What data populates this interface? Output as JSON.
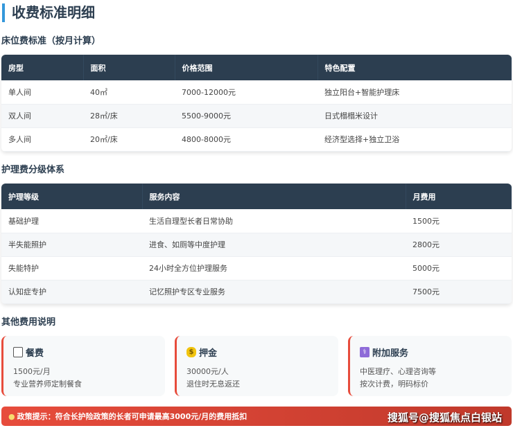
{
  "title": "收费标准明细",
  "bed": {
    "heading": "床位费标准（按月计算）",
    "headers": [
      "房型",
      "面积",
      "价格范围",
      "特色配置"
    ],
    "rows": [
      [
        "单人间",
        "40㎡",
        "7000-12000元",
        "独立阳台+智能护理床"
      ],
      [
        "双人间",
        "28㎡/床",
        "5500-9000元",
        "日式榻榻米设计"
      ],
      [
        "多人间",
        "20㎡/床",
        "4800-8000元",
        "经济型选择+独立卫浴"
      ]
    ]
  },
  "care": {
    "heading": "护理费分级体系",
    "headers": [
      "护理等级",
      "服务内容",
      "月费用"
    ],
    "rows": [
      [
        "基础护理",
        "生活自理型长者日常协助",
        "1500元"
      ],
      [
        "半失能照护",
        "进食、如厕等中度护理",
        "2800元"
      ],
      [
        "失能特护",
        "24小时全方位护理服务",
        "5000元"
      ],
      [
        "认知症专护",
        "记忆照护专区专业服务",
        "7500元"
      ]
    ]
  },
  "other": {
    "heading": "其他费用说明",
    "cards": [
      {
        "icon": "utensils-icon",
        "title": "餐费",
        "lines": [
          "1500元/月",
          "专业营养师定制餐食"
        ]
      },
      {
        "icon": "money-bag-icon",
        "title": "押金",
        "lines": [
          "30000元/人",
          "退住时无息返还"
        ]
      },
      {
        "icon": "medical-icon",
        "title": "附加服务",
        "lines": [
          "中医理疗、心理咨询等",
          "按次计费，明码标价"
        ]
      }
    ]
  },
  "banner": {
    "text": "政策提示：符合长护险政策的长者可申请最高3000元/月的费用抵扣"
  },
  "watermark": "搜狐号@搜狐焦点白银站",
  "colors": {
    "accent": "#3498db",
    "header": "#2c3e50",
    "alert": "#e74c3c"
  }
}
